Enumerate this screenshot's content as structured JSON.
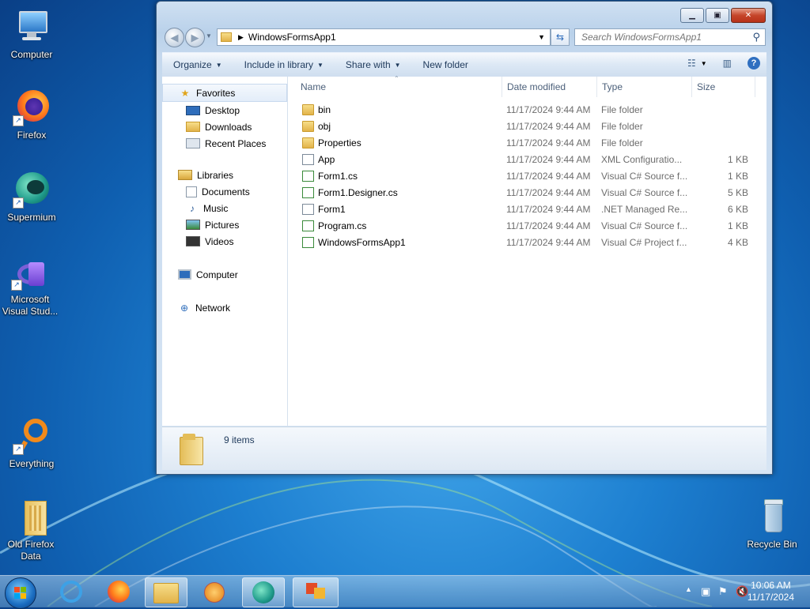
{
  "desktop": {
    "icons": [
      {
        "label": "Computer"
      },
      {
        "label": "Firefox"
      },
      {
        "label": "Supermium"
      },
      {
        "label": "Microsoft Visual Stud..."
      },
      {
        "label": "Everything"
      },
      {
        "label": "Old Firefox Data"
      },
      {
        "label": "Recycle Bin"
      }
    ]
  },
  "window": {
    "address": {
      "path_segment": "WindowsFormsApp1"
    },
    "search": {
      "placeholder": "Search WindowsFormsApp1"
    },
    "toolbar": {
      "organize": "Organize",
      "include_in_library": "Include in library",
      "share_with": "Share with",
      "new_folder": "New folder"
    },
    "nav": {
      "favorites": "Favorites",
      "favorites_items": [
        "Desktop",
        "Downloads",
        "Recent Places"
      ],
      "libraries": "Libraries",
      "libraries_items": [
        "Documents",
        "Music",
        "Pictures",
        "Videos"
      ],
      "computer": "Computer",
      "network": "Network"
    },
    "columns": {
      "name": "Name",
      "date": "Date modified",
      "type": "Type",
      "size": "Size"
    },
    "files": [
      {
        "name": "bin",
        "date": "11/17/2024 9:44 AM",
        "type": "File folder",
        "size": "",
        "icon": "folder-icon"
      },
      {
        "name": "obj",
        "date": "11/17/2024 9:44 AM",
        "type": "File folder",
        "size": "",
        "icon": "folder-icon"
      },
      {
        "name": "Properties",
        "date": "11/17/2024 9:44 AM",
        "type": "File folder",
        "size": "",
        "icon": "folder-icon"
      },
      {
        "name": "App",
        "date": "11/17/2024 9:44 AM",
        "type": "XML Configuratio...",
        "size": "1 KB",
        "icon": "xml-file-icon"
      },
      {
        "name": "Form1.cs",
        "date": "11/17/2024 9:44 AM",
        "type": "Visual C# Source f...",
        "size": "1 KB",
        "icon": "csharp-file-icon"
      },
      {
        "name": "Form1.Designer.cs",
        "date": "11/17/2024 9:44 AM",
        "type": "Visual C# Source f...",
        "size": "5 KB",
        "icon": "csharp-file-icon"
      },
      {
        "name": "Form1",
        "date": "11/17/2024 9:44 AM",
        "type": ".NET Managed Re...",
        "size": "6 KB",
        "icon": "resx-file-icon"
      },
      {
        "name": "Program.cs",
        "date": "11/17/2024 9:44 AM",
        "type": "Visual C# Source f...",
        "size": "1 KB",
        "icon": "csharp-file-icon"
      },
      {
        "name": "WindowsFormsApp1",
        "date": "11/17/2024 9:44 AM",
        "type": "Visual C# Project f...",
        "size": "4 KB",
        "icon": "csproj-file-icon"
      }
    ],
    "status": {
      "item_count": "9 items"
    }
  },
  "taskbar": {
    "clock_time": "10:06 AM",
    "clock_date": "11/17/2024"
  }
}
